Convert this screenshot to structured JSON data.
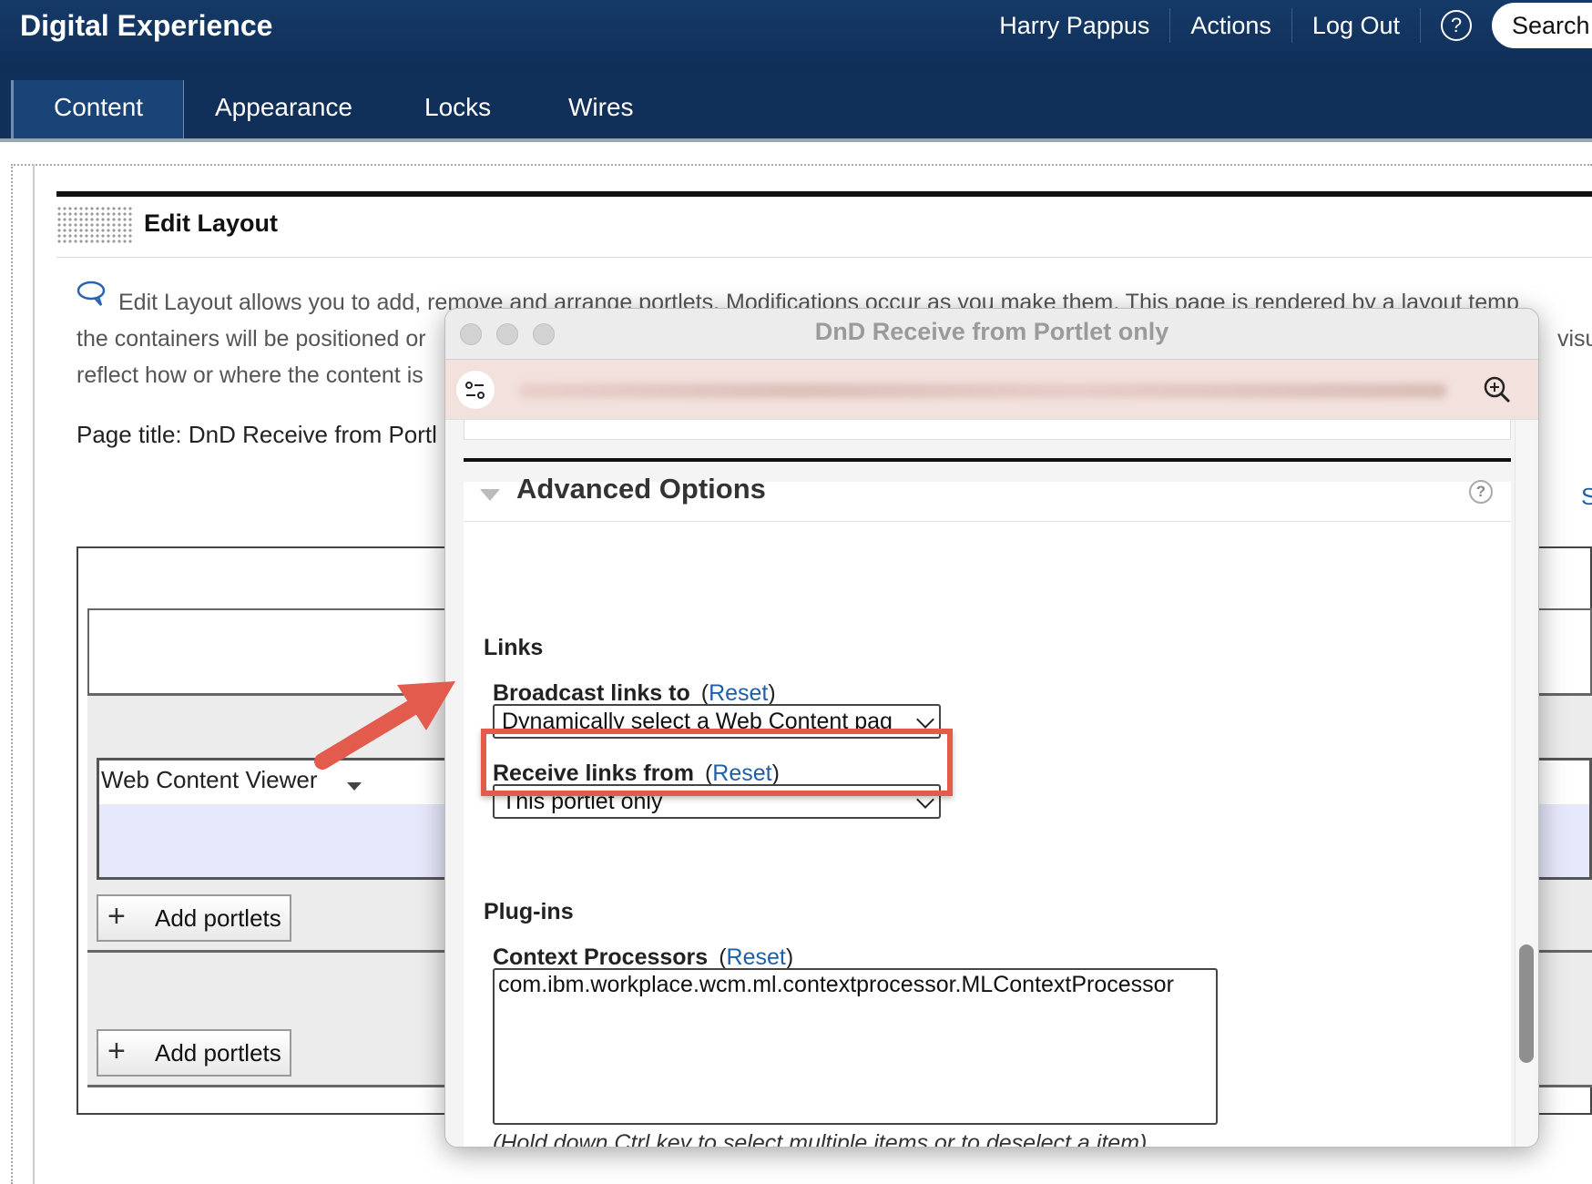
{
  "header": {
    "brand": "Digital Experience",
    "user": "Harry Pappus",
    "actions": "Actions",
    "logout": "Log Out",
    "help": "?",
    "search": "Search"
  },
  "tabs": [
    "Content",
    "Appearance",
    "Locks",
    "Wires"
  ],
  "page": {
    "edit_layout_title": "Edit Layout",
    "desc_line1": "Edit Layout allows you to add, remove and arrange portlets. Modifications occur as you make them. This page is rendered by a layout temp",
    "desc_line2": "the containers will be positioned or",
    "desc_line2_tail": "visua",
    "desc_line3": "reflect how or where the content is",
    "page_title": "Page title: DnD Receive from Portl",
    "right_link": "S",
    "portlet_name": "Web Content Viewer",
    "add_portlets_1": "Add portlets",
    "add_portlets_2": "Add portlets"
  },
  "modal": {
    "window_title": "DnD Receive from Portlet only",
    "advanced_options": "Advanced Options",
    "help": "?",
    "links_heading": "Links",
    "broadcast_label": "Broadcast links to",
    "broadcast_value": "Dynamically select a Web Content pag",
    "receive_label": "Receive links from",
    "receive_value": "This portlet only",
    "reset": "Reset",
    "plugins_heading": "Plug-ins",
    "context_label": "Context Processors",
    "context_value": "com.ibm.workplace.wcm.ml.contextprocessor.MLContextProcessor",
    "hint": "(Hold down Ctrl key to select multiple items or to deselect a item)"
  },
  "colors": {
    "header_bg": "#153a68",
    "tab_active_bg": "#1a4478",
    "highlight": "#e35b4d",
    "link": "#1f5fa8"
  }
}
